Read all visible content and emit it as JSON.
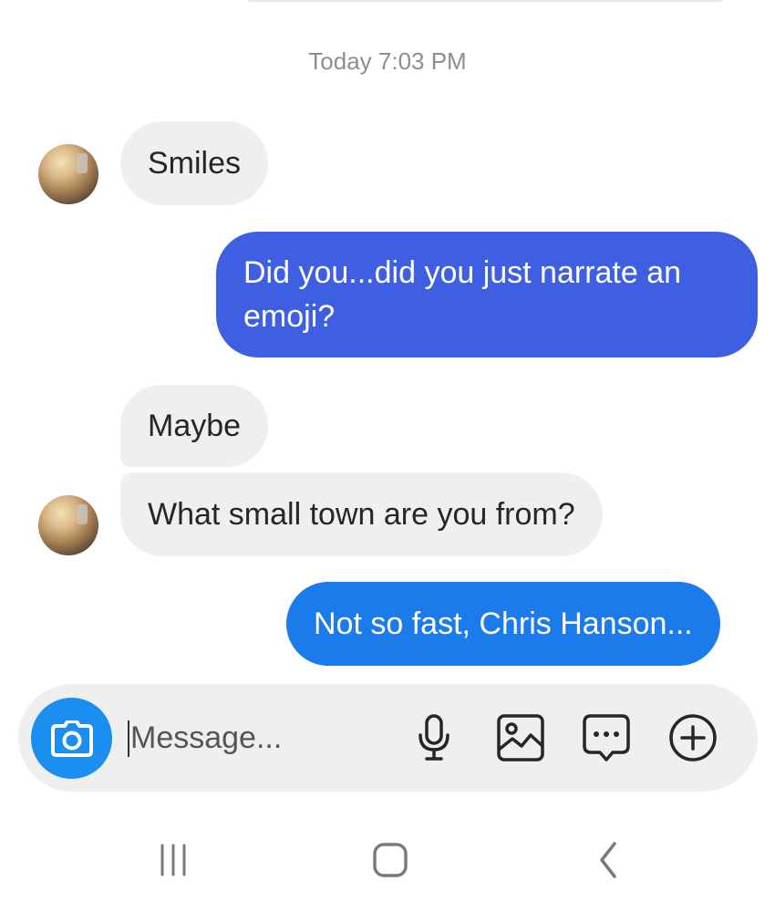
{
  "conversation": {
    "timestamp": "Today 7:03 PM",
    "messages": [
      {
        "sender": "them",
        "text": "Smiles"
      },
      {
        "sender": "me",
        "text": "Did you...did you just narrate an emoji?"
      },
      {
        "sender": "them",
        "text": "Maybe"
      },
      {
        "sender": "them",
        "text": "What small town are you from?"
      },
      {
        "sender": "me",
        "text": "Not so fast, Chris Hanson..."
      }
    ]
  },
  "composer": {
    "placeholder": "Message...",
    "value": "",
    "icons": [
      "camera-icon",
      "microphone-icon",
      "image-icon",
      "sticker-icon",
      "plus-icon"
    ]
  },
  "navigation": {
    "icons": [
      "recent-apps-icon",
      "home-icon",
      "back-icon"
    ]
  },
  "colors": {
    "incoming_bubble": "#efefef",
    "outgoing_bubble_1": "#3f5fe2",
    "outgoing_bubble_2": "#1b7bea",
    "camera_button": "#1b8ef2",
    "timestamp_text": "#8e8e8e"
  }
}
